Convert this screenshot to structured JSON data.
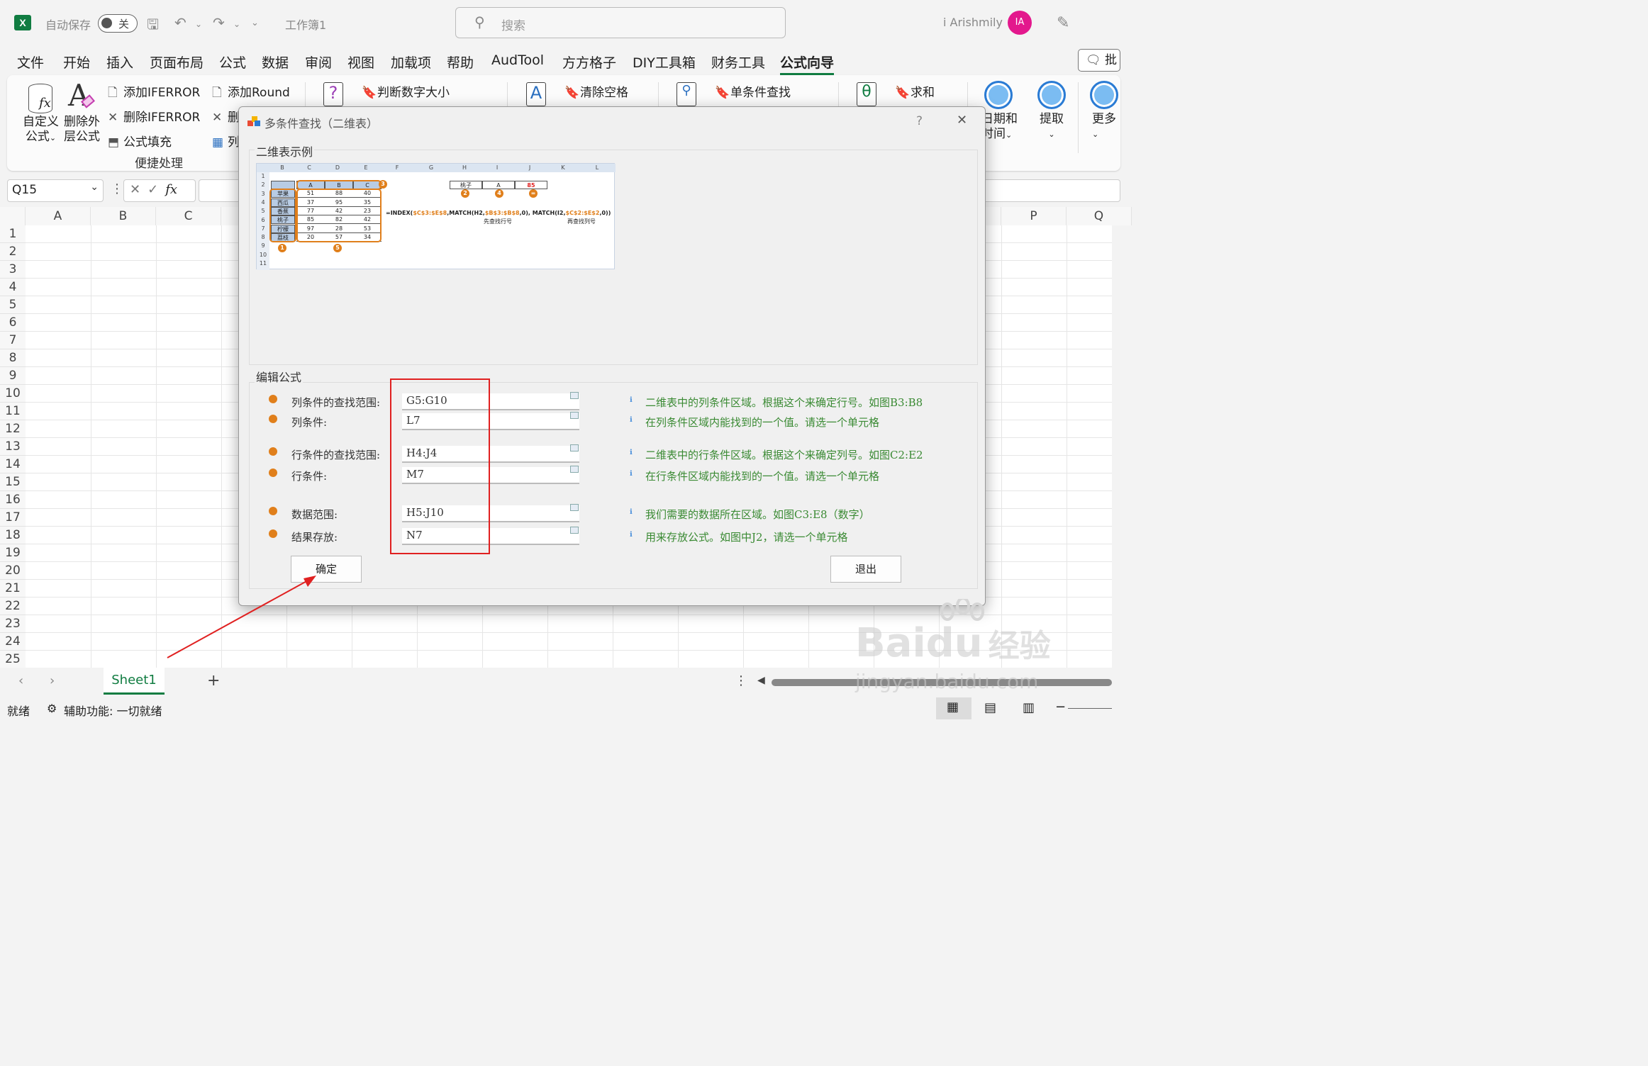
{
  "titlebar": {
    "autosave_label": "自动保存",
    "autosave_state": "关",
    "doc_name": "工作簿1",
    "search_placeholder": "搜索",
    "user_name": "i Arishmily",
    "user_initials": "IA"
  },
  "menu_tabs": [
    "文件",
    "开始",
    "插入",
    "页面布局",
    "公式",
    "数据",
    "审阅",
    "视图",
    "加载项",
    "帮助",
    "AudTool",
    "方方格子",
    "DIY工具箱",
    "财务工具",
    "公式向导"
  ],
  "active_tab": "公式向导",
  "share_label": "批",
  "ribbon": {
    "custom_formula": [
      "自定义",
      "公式"
    ],
    "delete_outer": [
      "删除外",
      "层公式"
    ],
    "add_iferror": "添加IFERROR",
    "del_iferror": "删除IFERROR",
    "formula_fill": "公式填充",
    "add_round": "添加Round",
    "del_round_partial": "删",
    "col_partial": "列",
    "group_label": "便捷处理",
    "judge_number": "判断数字大小",
    "clear_space": "清除空格",
    "single_lookup": "单条件查找",
    "sum": "求和",
    "date_time": [
      "日期和",
      "时间"
    ],
    "extract": "提取",
    "more": "更多"
  },
  "formula_bar": {
    "cell_ref": "Q15",
    "fx_glyph": "fx"
  },
  "grid": {
    "columns": [
      "A",
      "B",
      "C",
      "P",
      "Q"
    ],
    "rows": [
      "1",
      "2",
      "3",
      "4",
      "5",
      "6",
      "7",
      "8",
      "9",
      "10",
      "11",
      "12",
      "13",
      "14",
      "15",
      "16",
      "17",
      "18",
      "19",
      "20",
      "21",
      "22",
      "23",
      "24",
      "25"
    ]
  },
  "sheet_tab": "Sheet1",
  "status": {
    "ready": "就绪",
    "accessibility": "辅助功能: 一切就绪"
  },
  "dialog": {
    "title": "多条件查找（二维表）",
    "help": "?",
    "close": "✕",
    "example_group": "二维表示例",
    "edit_group": "编辑公式",
    "fields": [
      {
        "label": "列条件的查找范围:",
        "value": "G5:G10",
        "hint": "二维表中的列条件区域。根据这个来确定行号。如图B3:B8"
      },
      {
        "label": "列条件:",
        "value": "L7",
        "hint": "在列条件区域内能找到的一个值。请选一个单元格"
      },
      {
        "label": "行条件的查找范围:",
        "value": "H4:J4",
        "hint": "二维表中的行条件区域。根据这个来确定列号。如图C2:E2"
      },
      {
        "label": "行条件:",
        "value": "M7",
        "hint": "在行条件区域内能找到的一个值。请选一个单元格"
      },
      {
        "label": "数据范围:",
        "value": "H5:J10",
        "hint": "我们需要的数据所在区域。如图C3:E8（数字）"
      },
      {
        "label": "结果存放:",
        "value": "N7",
        "hint": "用来存放公式。如图中J2，请选一个单元格"
      }
    ],
    "ok_button": "确定",
    "exit_button": "退出"
  },
  "example": {
    "col_headers": [
      "B",
      "C",
      "D",
      "E",
      "F",
      "G",
      "H",
      "I",
      "J",
      "K",
      "L"
    ],
    "row_headers": [
      "1",
      "2",
      "3",
      "4",
      "5",
      "6",
      "7",
      "8",
      "9",
      "10",
      "11"
    ],
    "header_row": [
      "A",
      "B",
      "C"
    ],
    "fruits": [
      "苹果",
      "西瓜",
      "香蕉",
      "桃子",
      "柠檬",
      "荔枝"
    ],
    "data": [
      [
        "51",
        "88",
        "40"
      ],
      [
        "37",
        "95",
        "35"
      ],
      [
        "77",
        "42",
        "23"
      ],
      [
        "85",
        "82",
        "42"
      ],
      [
        "97",
        "28",
        "53"
      ],
      [
        "20",
        "57",
        "34"
      ]
    ],
    "lookup_row": [
      "桃子",
      "A",
      "85"
    ],
    "formula_parts": [
      "=INDEX(",
      "$C$3:$E$8",
      ",MATCH(H2,",
      "$B$3:$B$8",
      ",0), MATCH(I2,",
      "$C$2:$E$2",
      ",0))"
    ],
    "note_row": "先查找行号",
    "note_col": "再查找列号",
    "markers": [
      "1",
      "2",
      "3",
      "4",
      "5",
      "="
    ]
  },
  "watermark": {
    "brand": "Bai",
    "brand2": "du",
    "cn": "经验",
    "url": "jingyan.baidu.com"
  },
  "colors": {
    "excel_green": "#107c41",
    "accent_orange": "#e07f1b",
    "hint_green": "#3a8a33",
    "highlight_red": "#e02020"
  }
}
